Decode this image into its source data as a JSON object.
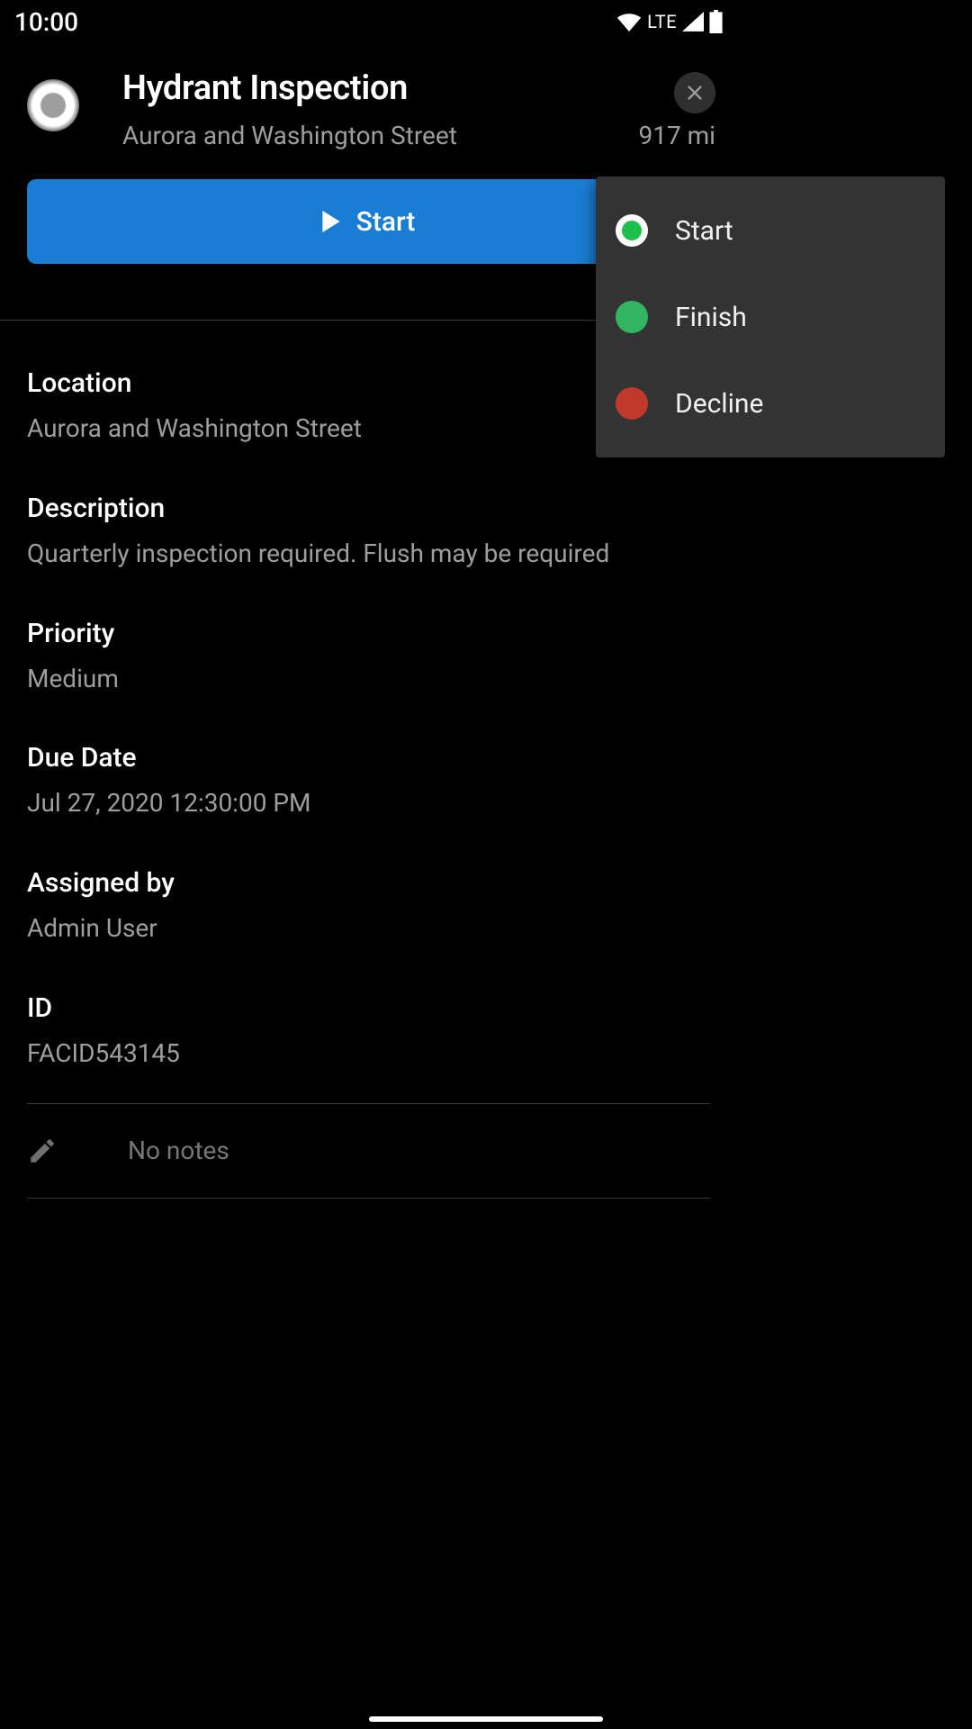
{
  "status_bar": {
    "time": "10:00",
    "network": "LTE"
  },
  "header": {
    "title": "Hydrant Inspection",
    "subtitle": "Aurora and Washington Street",
    "distance": "917 mi"
  },
  "primary_button": {
    "label": "Start"
  },
  "menu": {
    "items": [
      {
        "label": "Start"
      },
      {
        "label": "Finish"
      },
      {
        "label": "Decline"
      }
    ]
  },
  "fields": {
    "location": {
      "label": "Location",
      "value": "Aurora and Washington Street"
    },
    "description": {
      "label": "Description",
      "value": "Quarterly inspection required. Flush may be required"
    },
    "priority": {
      "label": "Priority",
      "value": "Medium"
    },
    "due_date": {
      "label": "Due Date",
      "value": "Jul 27, 2020 12:30:00 PM"
    },
    "assigned_by": {
      "label": "Assigned by",
      "value": "Admin User"
    },
    "id": {
      "label": "ID",
      "value": "FACID543145"
    }
  },
  "notes": {
    "placeholder": "No notes"
  }
}
